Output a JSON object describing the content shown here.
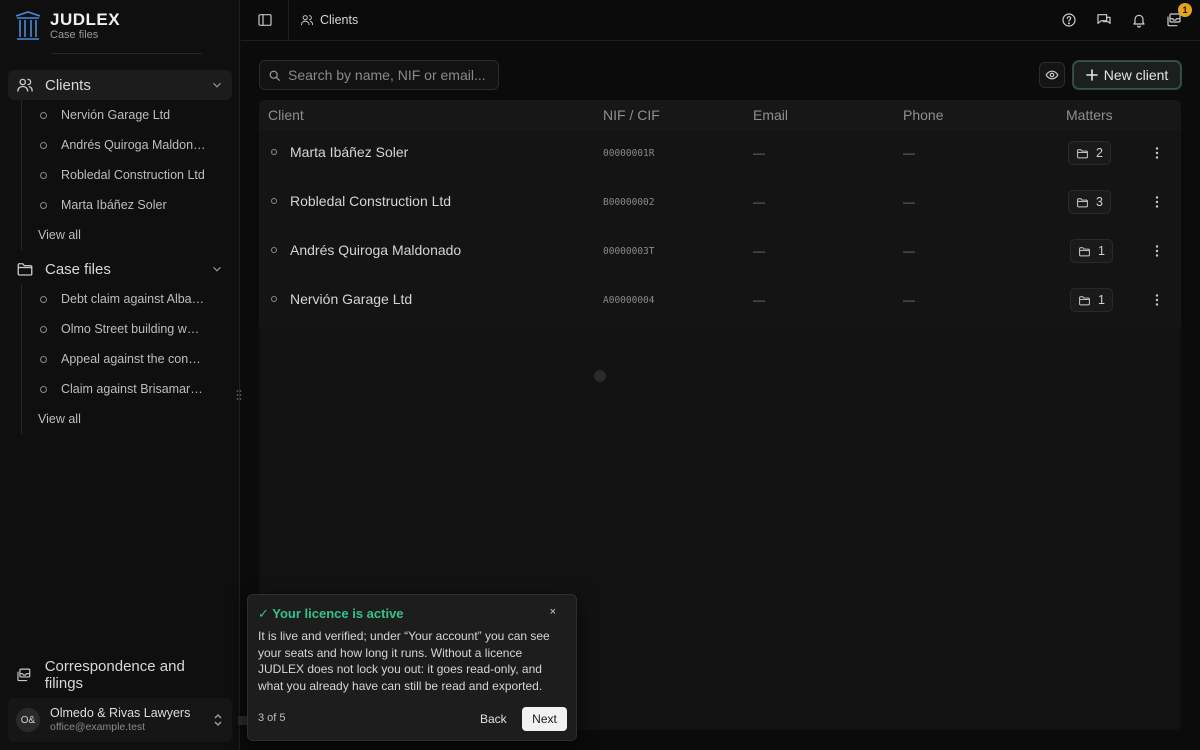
{
  "brand": {
    "name": "JUDLEX",
    "subtitle": "Case files"
  },
  "sidebar": {
    "clients": {
      "label": "Clients",
      "items": [
        "Nervión Garage Ltd",
        "Andrés Quiroga Maldonado",
        "Robledal Construction Ltd",
        "Marta Ibáñez Soler"
      ],
      "view_all": "View all"
    },
    "case_files": {
      "label": "Case files",
      "items": [
        "Debt claim against Albarracín",
        "Olmo Street building works",
        "Appeal against the construction",
        "Claim against Brisamar Inc."
      ],
      "view_all": "View all"
    },
    "correspondence": "Correspondence and filings",
    "account": {
      "initials": "O&",
      "name": "Olmedo & Rivas Lawyers",
      "email": "office@example.test"
    }
  },
  "topbar": {
    "breadcrumb": "Clients",
    "notification_badge": "1"
  },
  "main": {
    "search_placeholder": "Search by name, NIF or email...",
    "new_client_label": "New client",
    "columns": {
      "client": "Client",
      "nif": "NIF / CIF",
      "email": "Email",
      "phone": "Phone",
      "matters": "Matters"
    },
    "rows": [
      {
        "client": "Marta Ibáñez Soler",
        "nif": "00000001R",
        "email": "—",
        "phone": "—",
        "matters": "2"
      },
      {
        "client": "Robledal Construction Ltd",
        "nif": "B00000002",
        "email": "—",
        "phone": "—",
        "matters": "3"
      },
      {
        "client": "Andrés Quiroga Maldonado",
        "nif": "00000003T",
        "email": "—",
        "phone": "—",
        "matters": "1"
      },
      {
        "client": "Nervión Garage Ltd",
        "nif": "A00000004",
        "email": "—",
        "phone": "—",
        "matters": "1"
      }
    ]
  },
  "tour": {
    "title": "✓ Your licence is active",
    "close": "×",
    "body": "It is live and verified; under “Your account” you can see your seats and how long it runs. Without a licence JUDLEX does not lock you out: it goes read-only, and what you already have can still be read and exported.",
    "step": "3 of 5",
    "back": "Back",
    "next": "Next"
  },
  "colors": {
    "accent_green": "#35c28a",
    "badge": "#e6a31e"
  }
}
